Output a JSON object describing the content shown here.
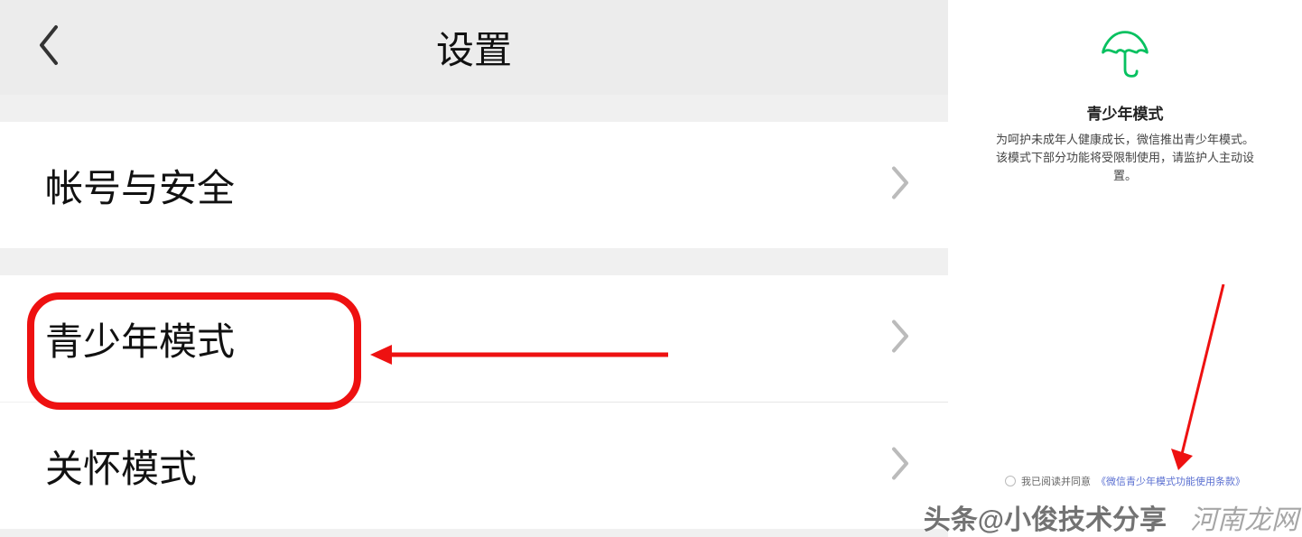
{
  "left": {
    "header_title": "设置",
    "items": [
      {
        "label": "帐号与安全"
      },
      {
        "label": "青少年模式"
      },
      {
        "label": "关怀模式"
      }
    ]
  },
  "right": {
    "title": "青少年模式",
    "description": "为呵护未成年人健康成长，微信推出青少年模式。该模式下部分功能将受限制使用，请监护人主动设置。",
    "agree_prefix": "我已阅读并同意",
    "agree_link": "《微信青少年模式功能使用条款》"
  },
  "annotations": {
    "highlight_color": "#e11",
    "icon_color_umbrella": "#07c160"
  },
  "watermarks": {
    "line1": "头条@小俊技术分享",
    "line2": "河南龙网"
  }
}
